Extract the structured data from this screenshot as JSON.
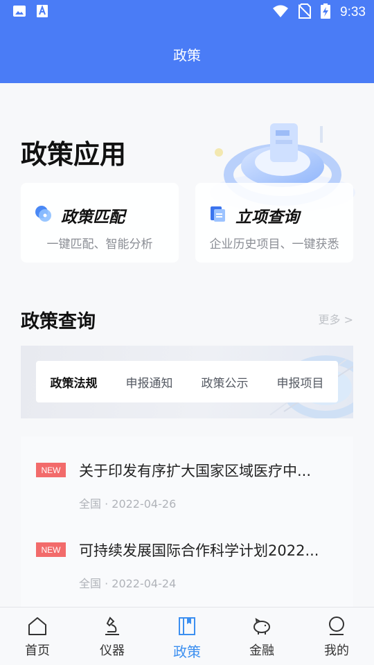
{
  "status_bar": {
    "time": "9:33",
    "left_icons": [
      "image-icon",
      "font-icon"
    ],
    "right_icons": [
      "wifi-icon",
      "no-sim-icon",
      "battery-charging-icon"
    ]
  },
  "nav": {
    "title": "政策"
  },
  "colors": {
    "brand": "#4a7cf6",
    "active_tab": "#3c8ff0",
    "badge": "#f26b6b"
  },
  "apps": {
    "title": "政策应用",
    "cards": [
      {
        "title": "政策匹配",
        "subtitle": "一键匹配、智能分析",
        "icon": "match-icon"
      },
      {
        "title": "立项查询",
        "subtitle": "企业历史项目、一键获悉",
        "icon": "document-icon"
      }
    ]
  },
  "query": {
    "title": "政策查询",
    "more": "更多 >",
    "tabs": [
      "政策法规",
      "申报通知",
      "政策公示",
      "申报项目"
    ],
    "active_tab": "政策法规"
  },
  "news": [
    {
      "badge": "NEW",
      "title": "关于印发有序扩大国家区域医疗中...",
      "meta": "全国 · 2022-04-26"
    },
    {
      "badge": "NEW",
      "title": "可持续发展国际合作科学计划2022...",
      "meta": "全国 · 2022-04-24"
    }
  ],
  "tabbar": {
    "items": [
      {
        "label": "首页",
        "icon": "home-icon"
      },
      {
        "label": "仪器",
        "icon": "microscope-icon"
      },
      {
        "label": "政策",
        "icon": "book-icon"
      },
      {
        "label": "金融",
        "icon": "piggy-bank-icon"
      },
      {
        "label": "我的",
        "icon": "user-icon"
      }
    ],
    "active": "政策"
  }
}
